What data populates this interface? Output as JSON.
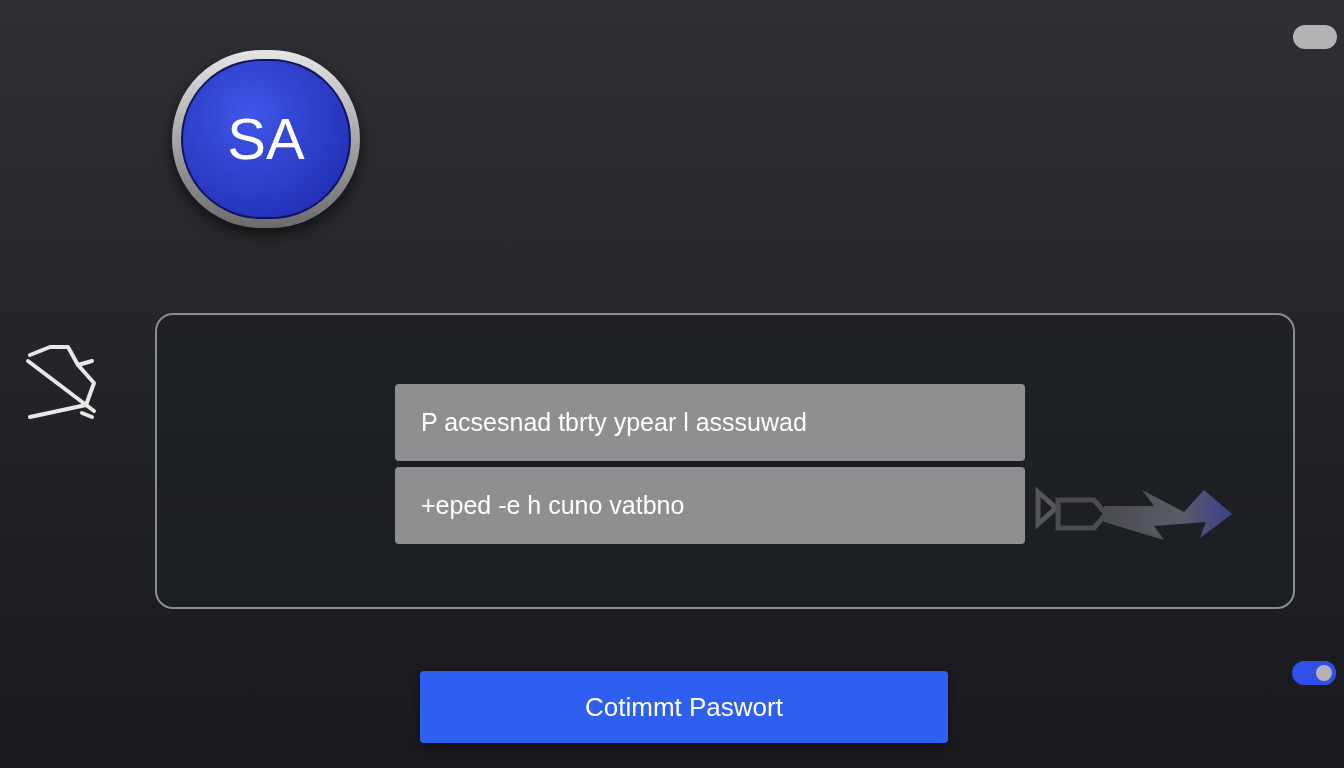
{
  "avatar": {
    "initials": "SA"
  },
  "toggles": [
    {
      "on": false
    },
    {
      "on": true
    }
  ],
  "fields": [
    {
      "value": "P acsesnad tbrty ypear l asssuwad"
    },
    {
      "value": "+eped -e h cuno vatbno"
    }
  ],
  "submit_button": {
    "label": "Cotimmt Paswort"
  }
}
